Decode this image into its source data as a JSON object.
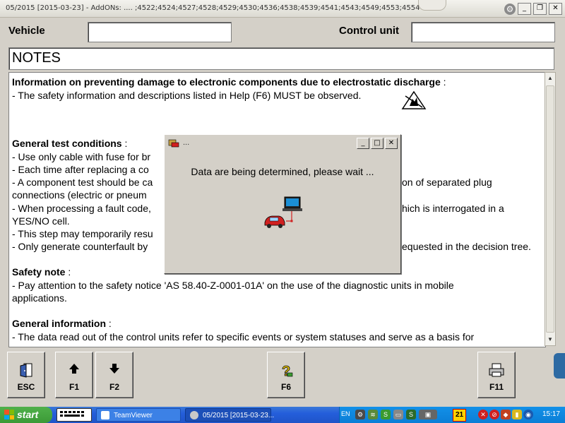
{
  "window": {
    "title": "05/2015 [2015-03-23] - AddONs:  .... ;4522;4524;4527;4528;4529;4530;4536;4538;4539;4541;4543;4549;4553;4554",
    "controls": {
      "gear": "⚙",
      "minimize": "_",
      "restore": "❐",
      "close": "✕"
    }
  },
  "header": {
    "vehicle_label": "Vehicle",
    "vehicle_value": "",
    "control_unit_label": "Control unit",
    "control_unit_value": ""
  },
  "notes": {
    "title": "NOTES"
  },
  "content": {
    "lines": [
      {
        "text": "Information on preventing damage to electronic components due to electrostatic discharge",
        "suffix": " :"
      },
      {
        "text": "- The safety information and descriptions listed in Help (F6) MUST be observed."
      },
      {
        "text": ""
      },
      {
        "text": ""
      },
      {
        "text": "General test conditions",
        "suffix": " :"
      },
      {
        "text": "- Use only cable with fuse for br"
      },
      {
        "text": "- Each time after replacing a co"
      },
      {
        "text": "- A component test should be ca",
        "tail": "on of separated plug"
      },
      {
        "text": "  connections (electric or pneum"
      },
      {
        "text": "- When processing a fault code,",
        "tail": "hich is interrogated in a"
      },
      {
        "text": "  YES/NO cell."
      },
      {
        "text": "- This step may temporarily resu"
      },
      {
        "text": "- Only generate counterfault by",
        "tail": "equested in the decision tree."
      },
      {
        "text": ""
      },
      {
        "text": "Safety note",
        "suffix": " :"
      },
      {
        "text": "- Pay attention to the safety notice 'AS 58.40-Z-0001-01A' on the use of the diagnostic units in mobile"
      },
      {
        "text": "  applications."
      },
      {
        "text": ""
      },
      {
        "text": "General information",
        "suffix": " :"
      },
      {
        "text": "- The data read out of the control units refer to specific events or system statuses and serve as a basis for"
      }
    ]
  },
  "toolbar": {
    "buttons": [
      {
        "id": "esc",
        "label": "ESC",
        "icon": "exit-door-icon"
      },
      {
        "id": "f1",
        "label": "F1",
        "icon": "arrow-up-icon"
      },
      {
        "id": "f2",
        "label": "F2",
        "icon": "arrow-down-icon"
      },
      {
        "id": "f6",
        "label": "F6",
        "icon": "help-question-icon"
      },
      {
        "id": "f11",
        "label": "F11",
        "icon": "printer-icon"
      }
    ]
  },
  "dialog": {
    "title": "...",
    "message": "Data are being determined, please wait ..."
  },
  "taskbar": {
    "start": "start",
    "teamviewer": "TeamViewer",
    "active_window": "05/2015 [2015-03-23...",
    "language": "EN",
    "badge_count": "21",
    "clock": "15:17"
  }
}
